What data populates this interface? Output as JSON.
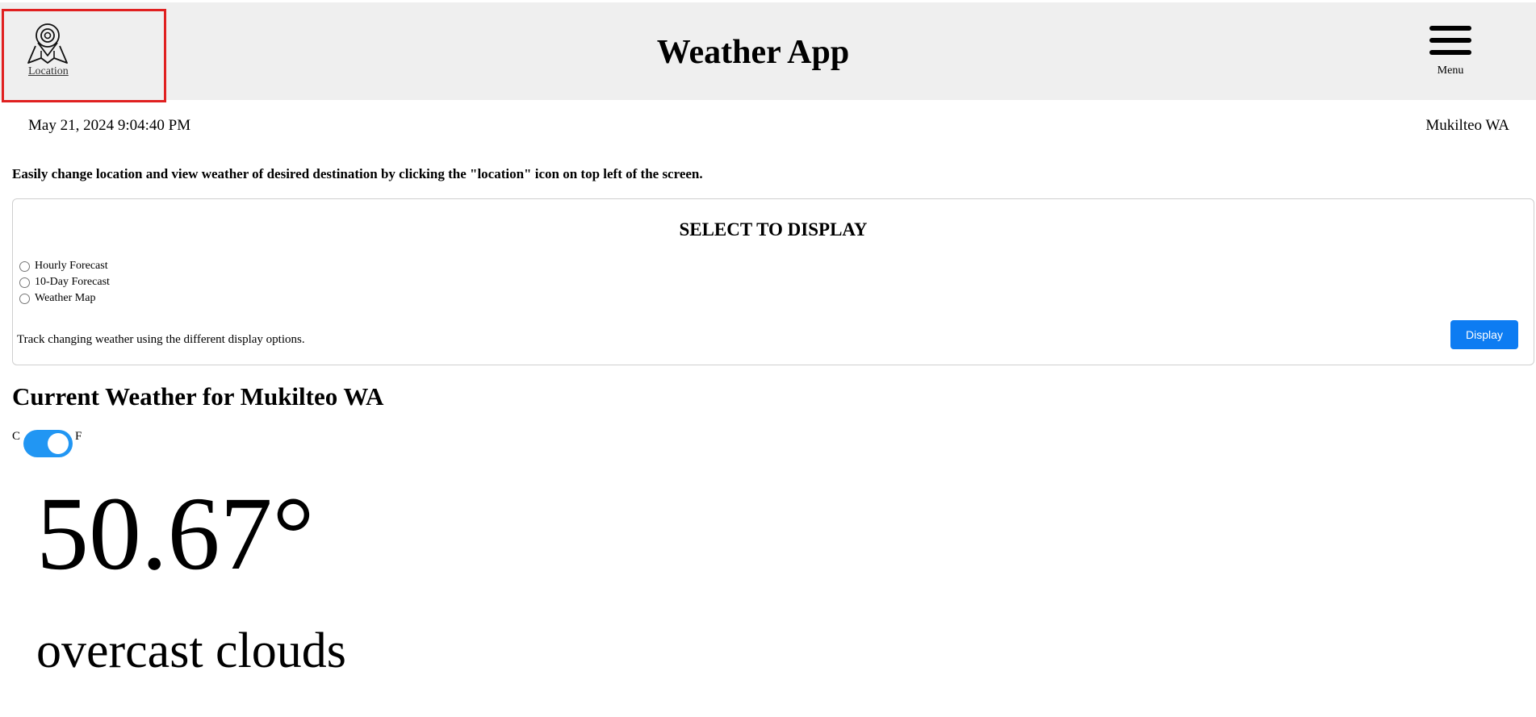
{
  "header": {
    "location_label": "Location",
    "location_icon": "map-pin-icon",
    "title": "Weather App",
    "menu_label": "Menu",
    "menu_icon": "hamburger-menu-icon"
  },
  "info_bar": {
    "datetime": "May 21, 2024 9:04:40 PM",
    "city": "Mukilteo WA"
  },
  "hint": "Easily change location and view weather of desired destination by clicking the \"location\" icon on top left of the screen.",
  "display_panel": {
    "title": "SELECT TO DISPLAY",
    "options": [
      {
        "label": "Hourly Forecast",
        "selected": false
      },
      {
        "label": "10-Day Forecast",
        "selected": false
      },
      {
        "label": "Weather Map",
        "selected": false
      }
    ],
    "helper_text": "Track changing weather using the different display options.",
    "button_label": "Display"
  },
  "current": {
    "heading": "Current Weather for Mukilteo WA",
    "unit_c": "C",
    "unit_f": "F",
    "unit_selected": "F",
    "temperature": "50.67°",
    "description": "overcast clouds"
  },
  "colors": {
    "header_bg": "#efefef",
    "accent_blue": "#0d7cf2",
    "toggle_blue": "#2196f3",
    "highlight_red": "#e02020"
  }
}
